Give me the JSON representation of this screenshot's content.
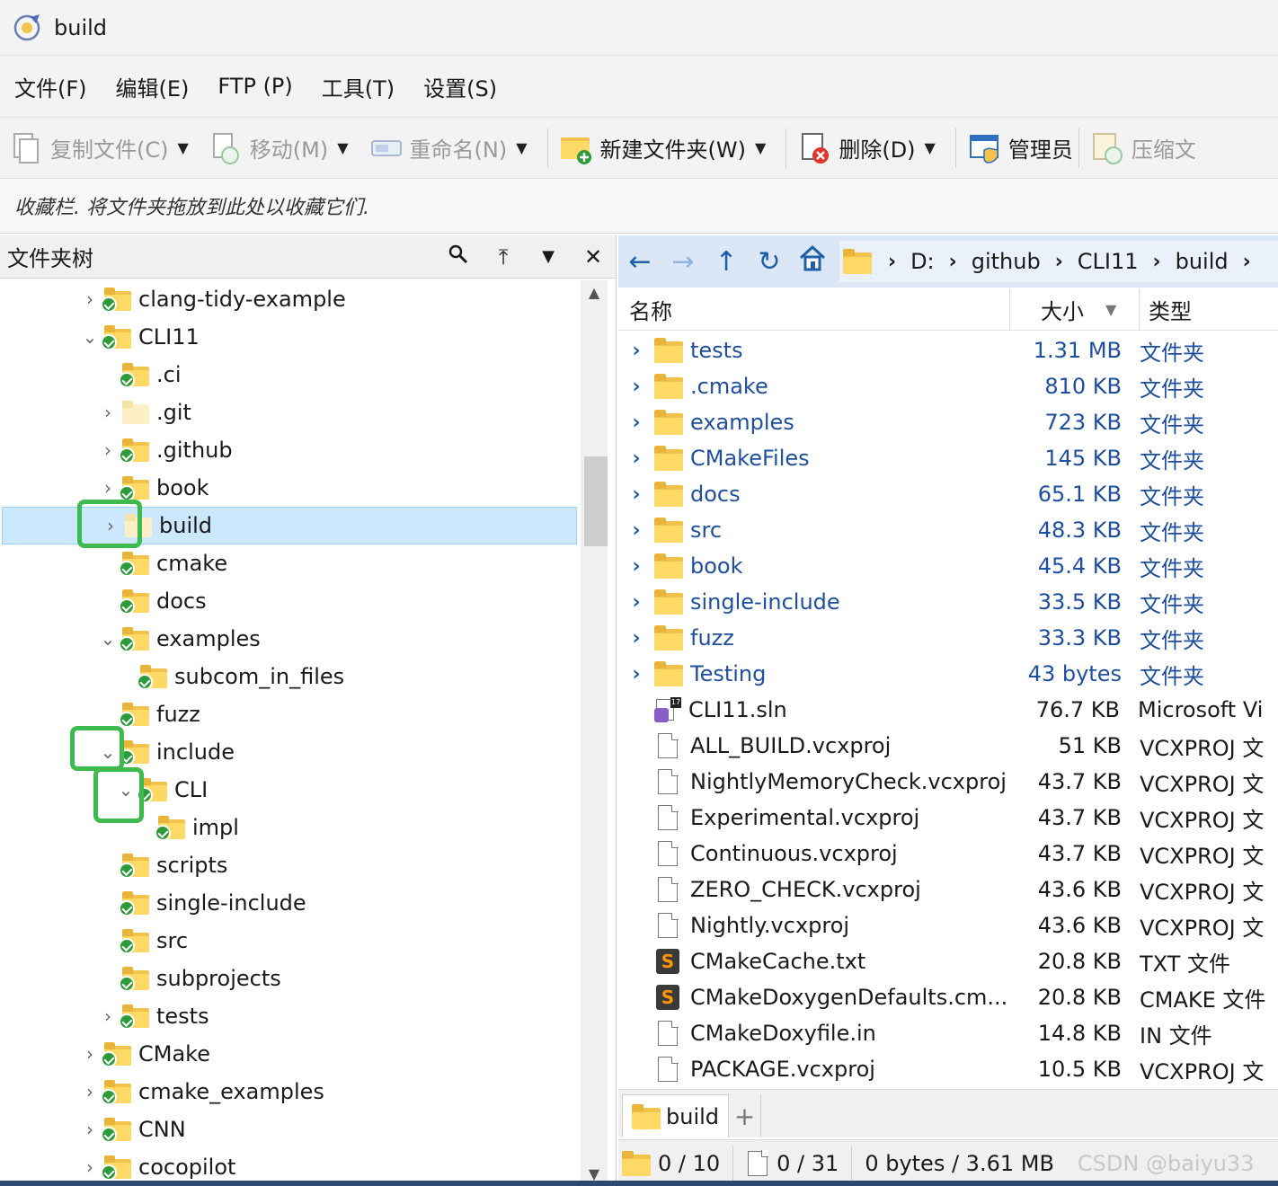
{
  "window": {
    "title": "build",
    "icon": "app-logo-icon"
  },
  "menu": [
    "文件(F)",
    "编辑(E)",
    "FTP (P)",
    "工具(T)",
    "设置(S)"
  ],
  "toolbar": {
    "copy": "复制文件(C)",
    "move": "移动(M)",
    "rename": "重命名(N)",
    "new_folder": "新建文件夹(W)",
    "delete": "删除(D)",
    "admin": "管理员",
    "compress": "压缩文"
  },
  "favorites": {
    "text": "收藏栏. 将文件夹拖放到此处以收藏它们."
  },
  "tree": {
    "title": "文件夹树",
    "items": [
      {
        "label": "clang-tidy-example",
        "depth": 0,
        "twisty": "›",
        "checked": true
      },
      {
        "label": "CLI11",
        "depth": 0,
        "twisty": "⌄",
        "checked": true
      },
      {
        "label": ".ci",
        "depth": 1,
        "twisty": "",
        "checked": true
      },
      {
        "label": ".git",
        "depth": 1,
        "twisty": "›",
        "checked": false
      },
      {
        "label": ".github",
        "depth": 1,
        "twisty": "›",
        "checked": true
      },
      {
        "label": "book",
        "depth": 1,
        "twisty": "›",
        "checked": true
      },
      {
        "label": "build",
        "depth": 1,
        "twisty": "›",
        "checked": false,
        "selected": true
      },
      {
        "label": "cmake",
        "depth": 1,
        "twisty": "",
        "checked": true
      },
      {
        "label": "docs",
        "depth": 1,
        "twisty": "",
        "checked": true
      },
      {
        "label": "examples",
        "depth": 1,
        "twisty": "⌄",
        "checked": true
      },
      {
        "label": "subcom_in_files",
        "depth": 2,
        "twisty": "",
        "checked": true
      },
      {
        "label": "fuzz",
        "depth": 1,
        "twisty": "",
        "checked": true
      },
      {
        "label": "include",
        "depth": 1,
        "twisty": "⌄",
        "checked": true
      },
      {
        "label": "CLI",
        "depth": 2,
        "twisty": "⌄",
        "checked": true
      },
      {
        "label": "impl",
        "depth": 3,
        "twisty": "",
        "checked": true
      },
      {
        "label": "scripts",
        "depth": 1,
        "twisty": "",
        "checked": true
      },
      {
        "label": "single-include",
        "depth": 1,
        "twisty": "",
        "checked": true
      },
      {
        "label": "src",
        "depth": 1,
        "twisty": "",
        "checked": true
      },
      {
        "label": "subprojects",
        "depth": 1,
        "twisty": "",
        "checked": true
      },
      {
        "label": "tests",
        "depth": 1,
        "twisty": "›",
        "checked": true
      },
      {
        "label": "CMake",
        "depth": 0,
        "twisty": "›",
        "checked": true
      },
      {
        "label": "cmake_examples",
        "depth": 0,
        "twisty": "›",
        "checked": true
      },
      {
        "label": "CNN",
        "depth": 0,
        "twisty": "›",
        "checked": true
      },
      {
        "label": "cocopilot",
        "depth": 0,
        "twisty": "›",
        "checked": true
      }
    ]
  },
  "breadcrumb": [
    "D:",
    "github",
    "CLI11",
    "build"
  ],
  "columns": {
    "name": "名称",
    "size": "大小",
    "type": "类型"
  },
  "files": [
    {
      "name": "tests",
      "size": "1.31 MB",
      "type": "文件夹",
      "kind": "folder"
    },
    {
      "name": ".cmake",
      "size": "810 KB",
      "type": "文件夹",
      "kind": "folder"
    },
    {
      "name": "examples",
      "size": "723 KB",
      "type": "文件夹",
      "kind": "folder"
    },
    {
      "name": "CMakeFiles",
      "size": "145 KB",
      "type": "文件夹",
      "kind": "folder"
    },
    {
      "name": "docs",
      "size": "65.1 KB",
      "type": "文件夹",
      "kind": "folder"
    },
    {
      "name": "src",
      "size": "48.3 KB",
      "type": "文件夹",
      "kind": "folder"
    },
    {
      "name": "book",
      "size": "45.4 KB",
      "type": "文件夹",
      "kind": "folder"
    },
    {
      "name": "single-include",
      "size": "33.5 KB",
      "type": "文件夹",
      "kind": "folder"
    },
    {
      "name": "fuzz",
      "size": "33.3 KB",
      "type": "文件夹",
      "kind": "folder"
    },
    {
      "name": "Testing",
      "size": "43 bytes",
      "type": "文件夹",
      "kind": "folder"
    },
    {
      "name": "CLI11.sln",
      "size": "76.7 KB",
      "type": "Microsoft Vi",
      "kind": "sln"
    },
    {
      "name": "ALL_BUILD.vcxproj",
      "size": "51 KB",
      "type": "VCXPROJ 文",
      "kind": "doc"
    },
    {
      "name": "NightlyMemoryCheck.vcxproj",
      "size": "43.7 KB",
      "type": "VCXPROJ 文",
      "kind": "doc"
    },
    {
      "name": "Experimental.vcxproj",
      "size": "43.7 KB",
      "type": "VCXPROJ 文",
      "kind": "doc"
    },
    {
      "name": "Continuous.vcxproj",
      "size": "43.7 KB",
      "type": "VCXPROJ 文",
      "kind": "doc"
    },
    {
      "name": "ZERO_CHECK.vcxproj",
      "size": "43.6 KB",
      "type": "VCXPROJ 文",
      "kind": "doc"
    },
    {
      "name": "Nightly.vcxproj",
      "size": "43.6 KB",
      "type": "VCXPROJ 文",
      "kind": "doc"
    },
    {
      "name": "CMakeCache.txt",
      "size": "20.8 KB",
      "type": "TXT 文件",
      "kind": "sublime"
    },
    {
      "name": "CMakeDoxygenDefaults.cm...",
      "size": "20.8 KB",
      "type": "CMAKE 文件",
      "kind": "sublime"
    },
    {
      "name": "CMakeDoxyfile.in",
      "size": "14.8 KB",
      "type": "IN 文件",
      "kind": "doc"
    },
    {
      "name": "PACKAGE.vcxproj",
      "size": "10.5 KB",
      "type": "VCXPROJ 文",
      "kind": "doc"
    }
  ],
  "tabs": [
    {
      "label": "build"
    }
  ],
  "tab_add": "+",
  "status": {
    "folders": "0 / 10",
    "files": "0 / 31",
    "bytes": "0 bytes / 3.61 MB"
  },
  "watermark": "CSDN @baiyu33",
  "colors": {
    "accent": "#1f4fa0",
    "highlight": "#3dbb4f",
    "selection": "#cce8ff",
    "navbar": "#dbe7f6"
  }
}
